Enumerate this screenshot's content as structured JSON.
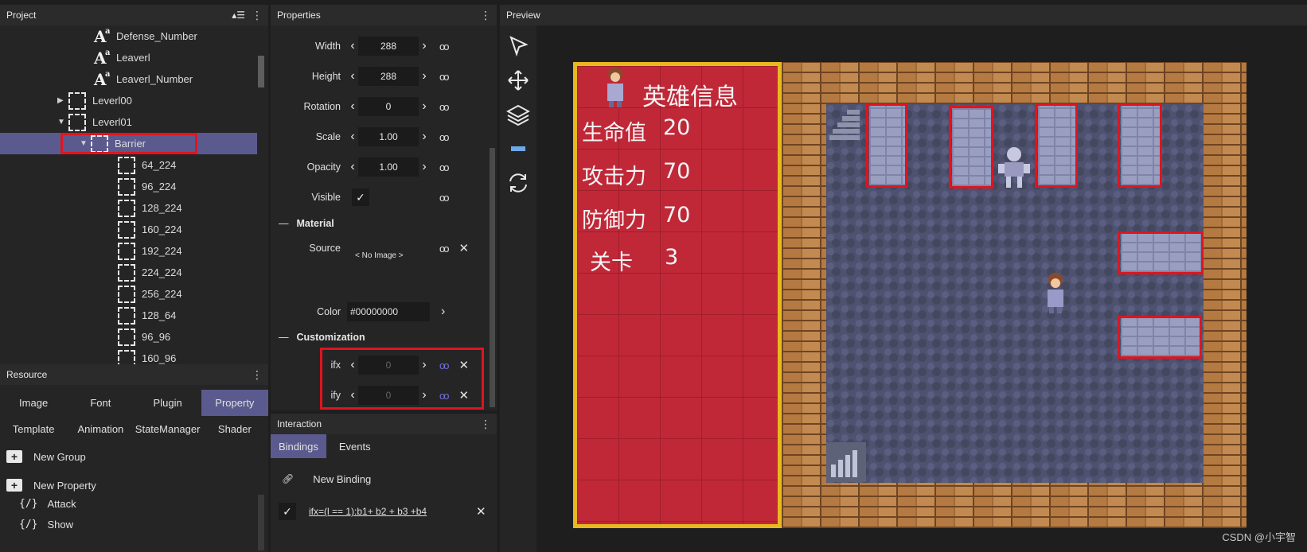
{
  "project": {
    "title": "Project",
    "tree": [
      {
        "label": "Defense_Number",
        "kind": "text"
      },
      {
        "label": "Leaverl",
        "kind": "text"
      },
      {
        "label": "Leaverl_Number",
        "kind": "text"
      },
      {
        "label": "Leverl00",
        "kind": "group",
        "expanded": false
      },
      {
        "label": "Leverl01",
        "kind": "group",
        "expanded": true
      },
      {
        "label": "Barrier",
        "kind": "group",
        "expanded": true,
        "selected": true
      },
      {
        "label": "64_224",
        "kind": "node"
      },
      {
        "label": "96_224",
        "kind": "node"
      },
      {
        "label": "128_224",
        "kind": "node"
      },
      {
        "label": "160_224",
        "kind": "node"
      },
      {
        "label": "192_224",
        "kind": "node"
      },
      {
        "label": "224_224",
        "kind": "node"
      },
      {
        "label": "256_224",
        "kind": "node"
      },
      {
        "label": "128_64",
        "kind": "node"
      },
      {
        "label": "96_96",
        "kind": "node"
      },
      {
        "label": "160_96",
        "kind": "node"
      }
    ]
  },
  "resource": {
    "title": "Resource",
    "tabs": [
      "Image",
      "Font",
      "Plugin",
      "Property",
      "Template",
      "Animation",
      "StateManager",
      "Shader"
    ],
    "active_tab": "Property",
    "actions": [
      "New Group",
      "New Property"
    ],
    "items": [
      "Attack",
      "Show"
    ]
  },
  "properties": {
    "title": "Properties",
    "width": {
      "label": "Width",
      "value": "288"
    },
    "height": {
      "label": "Height",
      "value": "288"
    },
    "rotation": {
      "label": "Rotation",
      "value": "0"
    },
    "scale": {
      "label": "Scale",
      "value": "1.00"
    },
    "opacity": {
      "label": "Opacity",
      "value": "1.00"
    },
    "visible": {
      "label": "Visible",
      "checked": true
    },
    "material_section": "Material",
    "source": {
      "label": "Source",
      "value": "< No Image >"
    },
    "color": {
      "label": "Color",
      "value": "#00000000"
    },
    "customization_section": "Customization",
    "ifx": {
      "label": "ifx",
      "value": "0"
    },
    "ify": {
      "label": "ify",
      "value": "0"
    }
  },
  "interaction": {
    "title": "Interaction",
    "tabs": [
      "Bindings",
      "Events"
    ],
    "active_tab": "Bindings",
    "new_binding": "New Binding",
    "binding_expr": "ifx=(l == 1):b1+ b2 + b3 +b4"
  },
  "preview": {
    "title": "Preview",
    "panel_title": "英雄信息",
    "stats": [
      {
        "label": "生命值",
        "value": "20"
      },
      {
        "label": "攻击力",
        "value": "70"
      },
      {
        "label": "防御力",
        "value": "70"
      },
      {
        "label": "关卡",
        "value": "3"
      }
    ],
    "watermark": "CSDN @小宇智"
  },
  "colors": {
    "accent": "#5a5a8e",
    "highlight": "#e0141e"
  }
}
